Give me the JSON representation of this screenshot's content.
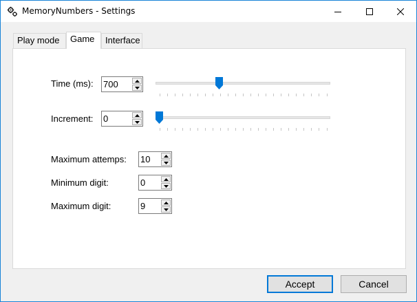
{
  "window": {
    "title": "MemoryNumbers - Settings",
    "controls": {
      "minimize": "minimize-icon",
      "maximize": "maximize-icon",
      "close": "close-icon"
    }
  },
  "tabs": [
    {
      "label": "Play mode",
      "active": false
    },
    {
      "label": "Game",
      "active": true
    },
    {
      "label": "Interface",
      "active": false
    }
  ],
  "game": {
    "time": {
      "label": "Time (ms):",
      "value": "700",
      "slider_fraction": 0.36
    },
    "increment": {
      "label": "Increment:",
      "value": "0",
      "slider_fraction": 0.0
    },
    "max_attempts": {
      "label": "Maximum attemps:",
      "value": "10"
    },
    "min_digit": {
      "label": "Minimum digit:",
      "value": "0"
    },
    "max_digit": {
      "label": "Maximum digit:",
      "value": "9"
    }
  },
  "buttons": {
    "accept": "Accept",
    "cancel": "Cancel"
  },
  "colors": {
    "accent": "#0078d7",
    "window_border": "#1883d7",
    "panel": "#ffffff",
    "background": "#f0f0f0"
  }
}
